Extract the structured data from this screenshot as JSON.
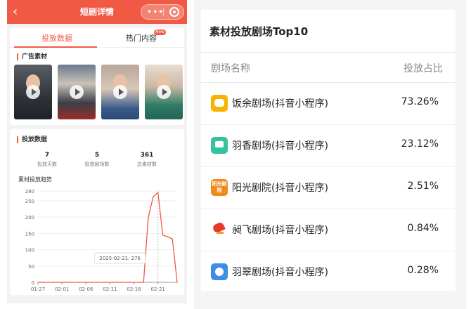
{
  "left_panel": {
    "nav": {
      "title": "短剧详情",
      "back_icon": "chevron-left-icon",
      "more_icon": "more-dots-icon",
      "close_icon": "target-circle-icon",
      "accent": "#f05a45"
    },
    "tabs": [
      {
        "label": "投放数据",
        "active": true
      },
      {
        "label": "热门内容",
        "active": false,
        "badge": "New"
      }
    ],
    "ad_section": {
      "title": "广告素材",
      "thumbnails": [
        {
          "icon": "play-icon"
        },
        {
          "icon": "play-icon"
        },
        {
          "icon": "play-icon"
        },
        {
          "icon": "play-icon"
        }
      ]
    },
    "delivery_section": {
      "title": "投放数据",
      "stats": [
        {
          "value": "7",
          "label": "投放天数"
        },
        {
          "value": "5",
          "label": "投放剧场数"
        },
        {
          "value": "361",
          "label": "总素材数"
        }
      ],
      "chart_title": "素材投放趋势",
      "tooltip": "2025-02-21: 276"
    }
  },
  "chart_data": {
    "type": "line",
    "title": "素材投放趋势",
    "x_ticks": [
      "01-27",
      "02-01",
      "02-06",
      "02-11",
      "02-16",
      "02-21"
    ],
    "y_ticks": [
      0,
      50,
      100,
      150,
      200,
      250,
      280
    ],
    "ylim": [
      0,
      280
    ],
    "grid": true,
    "color": "#f05a45",
    "series": [
      {
        "points": [
          [
            "01-27",
            0
          ],
          [
            "02-01",
            0
          ],
          [
            "02-06",
            0
          ],
          [
            "02-11",
            0
          ],
          [
            "02-16",
            0
          ],
          [
            "02-17",
            0
          ],
          [
            "02-18",
            0
          ],
          [
            "02-19",
            200
          ],
          [
            "02-20",
            262
          ],
          [
            "02-21",
            276
          ],
          [
            "02-22",
            145
          ],
          [
            "02-23",
            140
          ],
          [
            "02-24",
            133
          ],
          [
            "02-25",
            0
          ]
        ]
      }
    ],
    "x_range": [
      "01-27",
      "02-25"
    ]
  },
  "right_panel": {
    "title": "素材投放剧场Top10",
    "columns": [
      "剧场名称",
      "投放占比"
    ],
    "rows": [
      {
        "name": "饭余剧场(抖音小程序)",
        "share": "73.26%",
        "logo": "fanyu-logo-icon"
      },
      {
        "name": "羽香剧场(抖音小程序)",
        "share": "23.12%",
        "logo": "yuxiang-logo-icon"
      },
      {
        "name": "阳光剧院(抖音小程序)",
        "share": "2.51%",
        "logo": "yangguang-logo-icon",
        "logo_text": "阳光剧院"
      },
      {
        "name": "昶飞剧场(抖音小程序)",
        "share": "0.84%",
        "logo": "yifei-logo-icon"
      },
      {
        "name": "羽翠剧场(抖音小程序)",
        "share": "0.28%",
        "logo": "yucui-logo-icon"
      }
    ]
  }
}
